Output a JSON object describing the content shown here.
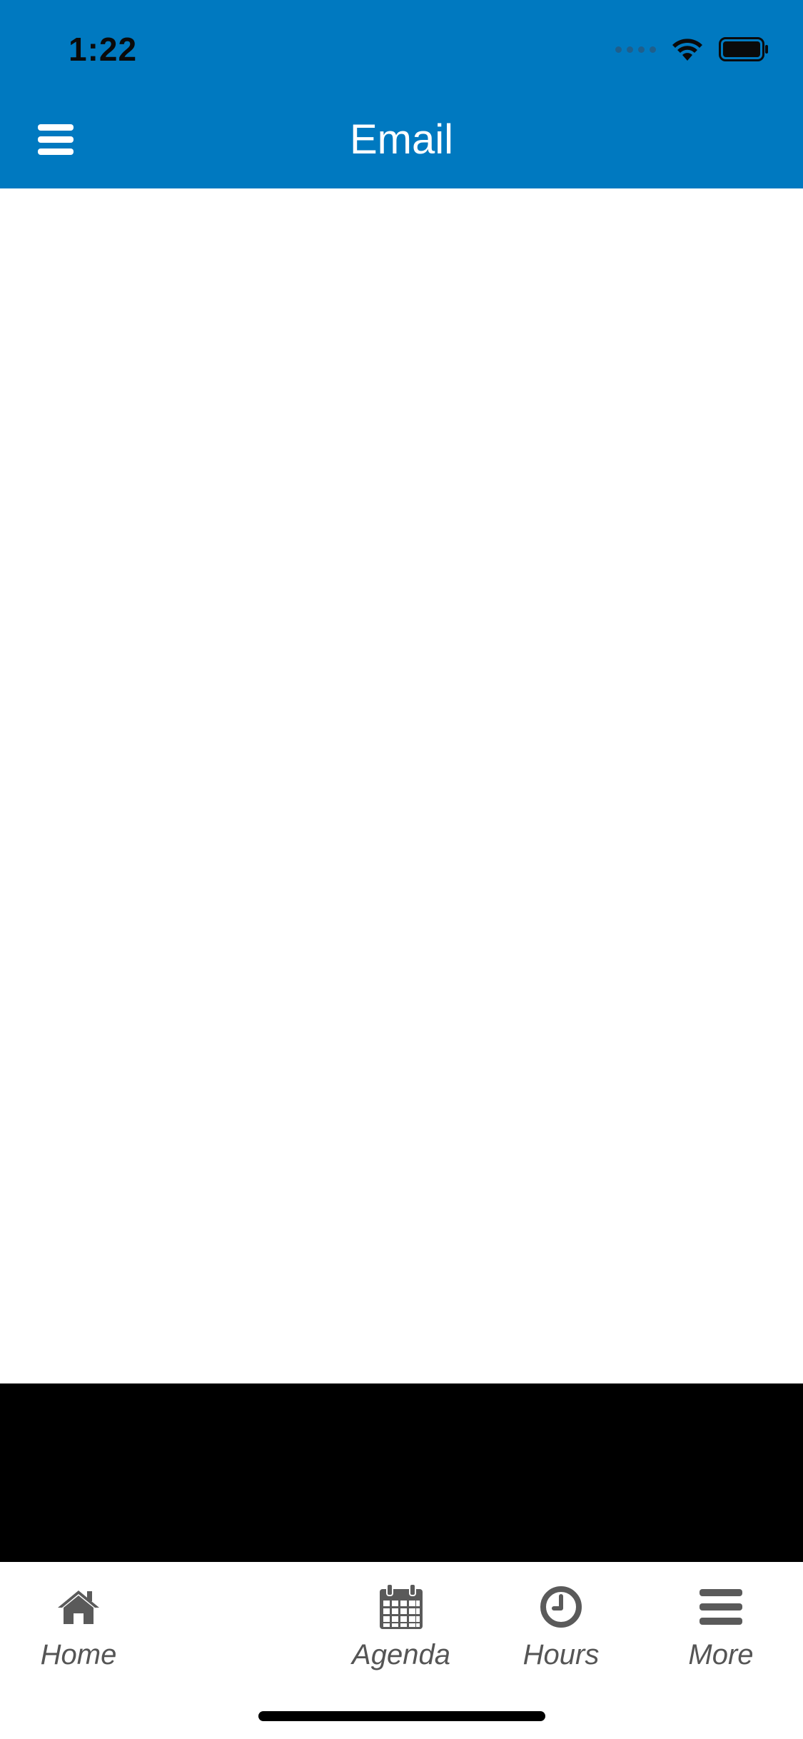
{
  "status_bar": {
    "time": "1:22"
  },
  "header": {
    "title": "Email",
    "menu_icon": "hamburger-menu-icon",
    "background_color": "#0079c0"
  },
  "tab_bar": {
    "items": [
      {
        "label": "Home",
        "icon": "home-icon"
      },
      {
        "label": "Agenda",
        "icon": "calendar-icon"
      },
      {
        "label": "Hours",
        "icon": "clock-icon"
      },
      {
        "label": "More",
        "icon": "more-menu-icon"
      }
    ],
    "icon_color": "#5a5a5a"
  }
}
